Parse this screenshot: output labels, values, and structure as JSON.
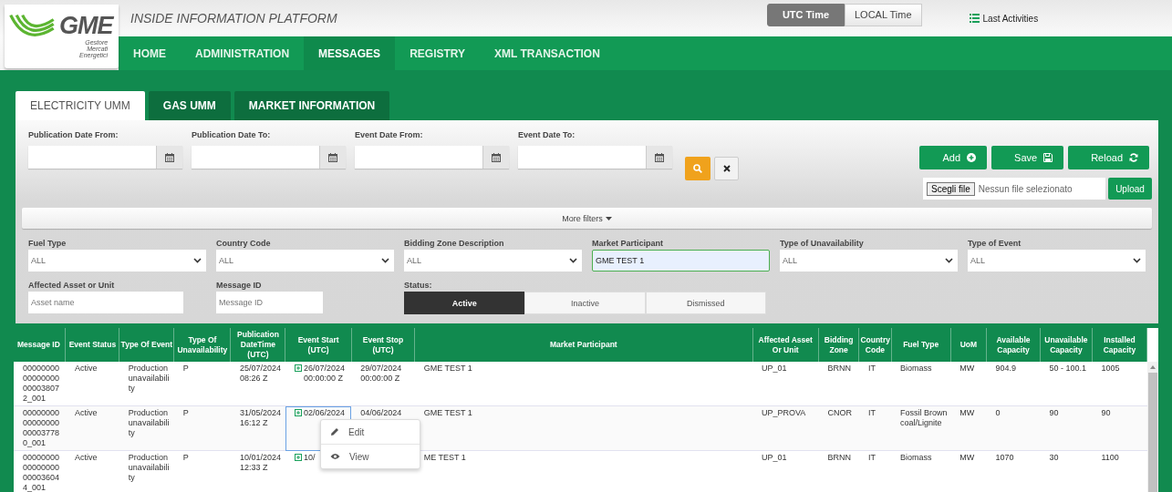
{
  "header": {
    "logo": {
      "name": "GME",
      "subtitle": [
        "Gestore",
        "Mercati",
        "Energetici"
      ]
    },
    "title": "INSIDE INFORMATION PLATFORM",
    "time_toggle": [
      {
        "label": "UTC Time",
        "selected": true
      },
      {
        "label": "LOCAL Time",
        "selected": false
      }
    ],
    "last_activities": "Last Activities"
  },
  "nav": [
    {
      "label": "HOME",
      "selected": false
    },
    {
      "label": "ADMINISTRATION",
      "selected": false
    },
    {
      "label": "MESSAGES",
      "selected": true
    },
    {
      "label": "REGISTRY",
      "selected": false
    },
    {
      "label": "XML TRANSACTION",
      "selected": false
    }
  ],
  "tabs": [
    {
      "label": "ELECTRICITY UMM",
      "selected": true
    },
    {
      "label": "GAS UMM",
      "selected": false
    },
    {
      "label": "MARKET INFORMATION",
      "selected": false
    }
  ],
  "date_filters": [
    {
      "label": "Publication Date From:"
    },
    {
      "label": "Publication Date To:"
    },
    {
      "label": "Event Date From:"
    },
    {
      "label": "Event Date To:"
    }
  ],
  "actions": [
    {
      "label": "Add",
      "kind": "add"
    },
    {
      "label": "Save",
      "kind": "save"
    },
    {
      "label": "Reload",
      "kind": "reload"
    }
  ],
  "file_upload": {
    "choose": "Scegli file",
    "status": "Nessun file selezionato",
    "upload": "Upload"
  },
  "more_filters": "More filters",
  "filters": [
    {
      "label": "Fuel Type",
      "kind": "select",
      "value": "ALL"
    },
    {
      "label": "Country Code",
      "kind": "select",
      "value": "ALL"
    },
    {
      "label": "Bidding Zone Description",
      "kind": "select",
      "value": "ALL"
    },
    {
      "label": "Market Participant",
      "kind": "input",
      "value": "GME TEST 1"
    },
    {
      "label": "Type of Unavailability",
      "kind": "select",
      "value": "ALL"
    },
    {
      "label": "Type of Event",
      "kind": "select",
      "value": "ALL"
    }
  ],
  "text_filters": [
    {
      "label": "Affected Asset or Unit",
      "placeholder": "Asset name"
    },
    {
      "label": "Message ID",
      "placeholder": "Message ID"
    }
  ],
  "status": {
    "label": "Status:",
    "options": [
      {
        "label": "Active",
        "selected": true
      },
      {
        "label": "Inactive",
        "selected": false
      },
      {
        "label": "Dismissed",
        "selected": false
      }
    ]
  },
  "table": {
    "columns": [
      "Message ID",
      "Event Status",
      "Type Of Event",
      "Type Of Unavailability",
      "Publication DateTime (UTC)",
      "Event Start (UTC)",
      "Event Stop (UTC)",
      "Market Participant",
      "Affected Asset Or Unit",
      "Bidding Zone",
      "Country Code",
      "Fuel Type",
      "UoM",
      "Available Capacity",
      "Unavailable Capacity",
      "Installed Capacity"
    ],
    "rows": [
      {
        "focused": false,
        "cells": [
          "0000000000000000000038072_001",
          "Active",
          "Production unavailability",
          "P",
          "25/07/2024 08:26 Z",
          "26/07/2024 00:00:00 Z",
          "29/07/2024 00:00:00 Z",
          "GME TEST 1",
          "UP_01",
          "BRNN",
          "IT",
          "Biomass",
          "MW",
          "904.9",
          "50 - 100.1",
          "1005"
        ]
      },
      {
        "focused": true,
        "cells": [
          "0000000000000000000037780_001",
          "Active",
          "Production unavailability",
          "P",
          "31/05/2024 16:12 Z",
          "02/06/2024",
          "04/06/2024",
          "GME TEST 1",
          "UP_PROVA",
          "CNOR",
          "IT",
          "Fossil Brown coal/Lignite",
          "MW",
          "0",
          "90",
          "90"
        ]
      },
      {
        "focused": false,
        "cells": [
          "0000000000000000000036044_001",
          "Active",
          "Production unavailability",
          "P",
          "10/01/2024 12:33 Z",
          "10/",
          null,
          "ME TEST 1",
          "UP_01",
          "BRNN",
          "IT",
          "Biomass",
          "MW",
          "1070",
          "30",
          "1100"
        ]
      }
    ]
  },
  "context_menu": [
    {
      "label": "Edit",
      "kind": "edit"
    },
    {
      "label": "View",
      "kind": "view"
    }
  ]
}
